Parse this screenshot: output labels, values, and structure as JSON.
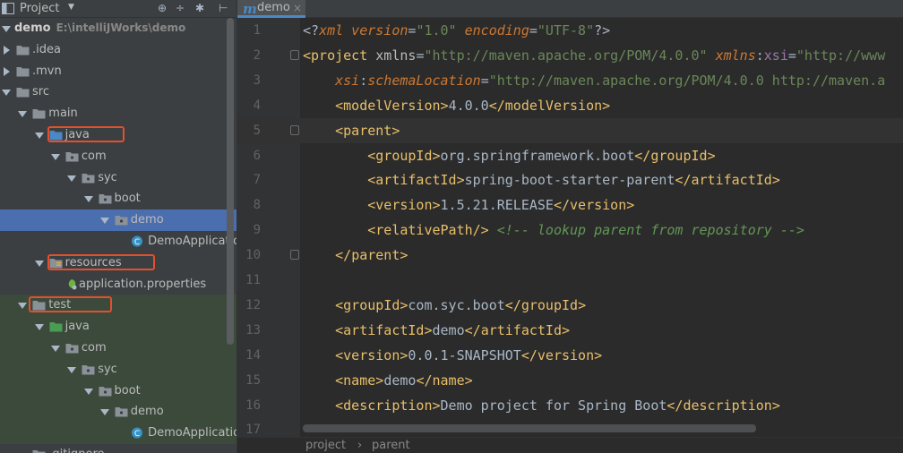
{
  "project_panel": {
    "title": "Project",
    "toolbar": [
      "⊕",
      "÷",
      "✱",
      "⊢"
    ],
    "tree": [
      {
        "label": "demo",
        "path": "E:\\intelliJWorks\\demo",
        "depth": 0,
        "expanded": true,
        "type": "module",
        "bold": true
      },
      {
        "label": ".idea",
        "depth": 0,
        "expanded": false,
        "type": "folder"
      },
      {
        "label": ".mvn",
        "depth": 0,
        "expanded": false,
        "type": "folder"
      },
      {
        "label": "src",
        "depth": 0,
        "expanded": true,
        "type": "folder"
      },
      {
        "label": "main",
        "depth": 1,
        "expanded": true,
        "type": "folder"
      },
      {
        "label": "java",
        "depth": 2,
        "expanded": true,
        "type": "source-folder",
        "highlight": true
      },
      {
        "label": "com",
        "depth": 3,
        "expanded": true,
        "type": "package"
      },
      {
        "label": "syc",
        "depth": 4,
        "expanded": true,
        "type": "package"
      },
      {
        "label": "boot",
        "depth": 5,
        "expanded": true,
        "type": "package"
      },
      {
        "label": "demo",
        "depth": 6,
        "expanded": true,
        "type": "package",
        "selected": true
      },
      {
        "label": "DemoApplication",
        "depth": 7,
        "type": "class"
      },
      {
        "label": "resources",
        "depth": 2,
        "expanded": true,
        "type": "resources-folder",
        "highlight": true
      },
      {
        "label": "application.properties",
        "depth": 3,
        "type": "properties"
      },
      {
        "label": "test",
        "depth": 1,
        "expanded": true,
        "type": "folder",
        "highlight": true,
        "test": true
      },
      {
        "label": "java",
        "depth": 2,
        "expanded": true,
        "type": "test-folder",
        "test": true
      },
      {
        "label": "com",
        "depth": 3,
        "expanded": true,
        "type": "package",
        "test": true
      },
      {
        "label": "syc",
        "depth": 4,
        "expanded": true,
        "type": "package",
        "test": true
      },
      {
        "label": "boot",
        "depth": 5,
        "expanded": true,
        "type": "package",
        "test": true
      },
      {
        "label": "demo",
        "depth": 6,
        "expanded": true,
        "type": "package",
        "test": true
      },
      {
        "label": "DemoApplicationT",
        "depth": 7,
        "type": "test-class",
        "test": true
      },
      {
        "label": ".gitignore",
        "depth": 1,
        "type": "file"
      }
    ]
  },
  "editor": {
    "tab": {
      "icon": "m",
      "label": "demo",
      "close": "×"
    },
    "current_line": 5,
    "lines": [
      {
        "n": "1",
        "fold": false,
        "tokens": [
          [
            "t-pi",
            "<?"
          ],
          [
            "t-pin",
            "xml version"
          ],
          [
            "t-pi",
            "="
          ],
          [
            "t-val",
            "\"1.0\""
          ],
          [
            "t-pi",
            " "
          ],
          [
            "t-pin",
            "encoding"
          ],
          [
            "t-pi",
            "="
          ],
          [
            "t-val",
            "\"UTF-8\""
          ],
          [
            "t-pi",
            "?>"
          ]
        ]
      },
      {
        "n": "2",
        "fold": true,
        "tokens": [
          [
            "t-br",
            "<"
          ],
          [
            "t-tag",
            "project"
          ],
          [
            "t-attr",
            " xmlns"
          ],
          [
            "t-txt",
            "="
          ],
          [
            "t-val",
            "\"http://maven.apache.org/POM/4.0.0\""
          ],
          [
            "t-attr",
            " "
          ],
          [
            "t-pin",
            "xmlns"
          ],
          [
            "t-txt",
            ":"
          ],
          [
            "t-ns",
            "xsi"
          ],
          [
            "t-txt",
            "="
          ],
          [
            "t-val",
            "\"http://www"
          ]
        ]
      },
      {
        "n": "3",
        "fold": false,
        "tokens": [
          [
            "t-txt",
            "    "
          ],
          [
            "t-pin",
            "xsi"
          ],
          [
            "t-txt",
            ":"
          ],
          [
            "t-pin",
            "schemaLocation"
          ],
          [
            "t-txt",
            "="
          ],
          [
            "t-val",
            "\"http://maven.apache.org/POM/4.0.0 http://maven.a"
          ]
        ]
      },
      {
        "n": "4",
        "fold": false,
        "tokens": [
          [
            "t-txt",
            "    "
          ],
          [
            "t-br",
            "<"
          ],
          [
            "t-tag",
            "modelVersion"
          ],
          [
            "t-br",
            ">"
          ],
          [
            "t-txt",
            "4.0.0"
          ],
          [
            "t-br",
            "</"
          ],
          [
            "t-tag",
            "modelVersion"
          ],
          [
            "t-br",
            ">"
          ]
        ]
      },
      {
        "n": "5",
        "fold": true,
        "tokens": [
          [
            "t-txt",
            "    "
          ],
          [
            "t-br",
            "<"
          ],
          [
            "t-tag",
            "parent"
          ],
          [
            "t-br",
            ">"
          ]
        ]
      },
      {
        "n": "6",
        "fold": false,
        "tokens": [
          [
            "t-txt",
            "        "
          ],
          [
            "t-br",
            "<"
          ],
          [
            "t-tag",
            "groupId"
          ],
          [
            "t-br",
            ">"
          ],
          [
            "t-txt",
            "org.springframework.boot"
          ],
          [
            "t-br",
            "</"
          ],
          [
            "t-tag",
            "groupId"
          ],
          [
            "t-br",
            ">"
          ]
        ]
      },
      {
        "n": "7",
        "fold": false,
        "tokens": [
          [
            "t-txt",
            "        "
          ],
          [
            "t-br",
            "<"
          ],
          [
            "t-tag",
            "artifactId"
          ],
          [
            "t-br",
            ">"
          ],
          [
            "t-txt",
            "spring-boot-starter-parent"
          ],
          [
            "t-br",
            "</"
          ],
          [
            "t-tag",
            "artifactId"
          ],
          [
            "t-br",
            ">"
          ]
        ]
      },
      {
        "n": "8",
        "fold": false,
        "tokens": [
          [
            "t-txt",
            "        "
          ],
          [
            "t-br",
            "<"
          ],
          [
            "t-tag",
            "version"
          ],
          [
            "t-br",
            ">"
          ],
          [
            "t-txt",
            "1.5.21.RELEASE"
          ],
          [
            "t-br",
            "</"
          ],
          [
            "t-tag",
            "version"
          ],
          [
            "t-br",
            ">"
          ]
        ]
      },
      {
        "n": "9",
        "fold": false,
        "tokens": [
          [
            "t-txt",
            "        "
          ],
          [
            "t-br",
            "<"
          ],
          [
            "t-tag",
            "relativePath"
          ],
          [
            "t-br",
            "/>"
          ],
          [
            "t-txt",
            " "
          ],
          [
            "t-cmt",
            "<!-- lookup parent from repository -->"
          ]
        ]
      },
      {
        "n": "10",
        "fold": true,
        "tokens": [
          [
            "t-txt",
            "    "
          ],
          [
            "t-br",
            "</"
          ],
          [
            "t-tag",
            "parent"
          ],
          [
            "t-br",
            ">"
          ]
        ]
      },
      {
        "n": "11",
        "fold": false,
        "tokens": []
      },
      {
        "n": "12",
        "fold": false,
        "tokens": [
          [
            "t-txt",
            "    "
          ],
          [
            "t-br",
            "<"
          ],
          [
            "t-tag",
            "groupId"
          ],
          [
            "t-br",
            ">"
          ],
          [
            "t-txt",
            "com.syc.boot"
          ],
          [
            "t-br",
            "</"
          ],
          [
            "t-tag",
            "groupId"
          ],
          [
            "t-br",
            ">"
          ]
        ]
      },
      {
        "n": "13",
        "fold": false,
        "tokens": [
          [
            "t-txt",
            "    "
          ],
          [
            "t-br",
            "<"
          ],
          [
            "t-tag",
            "artifactId"
          ],
          [
            "t-br",
            ">"
          ],
          [
            "t-txt",
            "demo"
          ],
          [
            "t-br",
            "</"
          ],
          [
            "t-tag",
            "artifactId"
          ],
          [
            "t-br",
            ">"
          ]
        ]
      },
      {
        "n": "14",
        "fold": false,
        "tokens": [
          [
            "t-txt",
            "    "
          ],
          [
            "t-br",
            "<"
          ],
          [
            "t-tag",
            "version"
          ],
          [
            "t-br",
            ">"
          ],
          [
            "t-txt",
            "0.0.1-SNAPSHOT"
          ],
          [
            "t-br",
            "</"
          ],
          [
            "t-tag",
            "version"
          ],
          [
            "t-br",
            ">"
          ]
        ]
      },
      {
        "n": "15",
        "fold": false,
        "tokens": [
          [
            "t-txt",
            "    "
          ],
          [
            "t-br",
            "<"
          ],
          [
            "t-tag",
            "name"
          ],
          [
            "t-br",
            ">"
          ],
          [
            "t-txt",
            "demo"
          ],
          [
            "t-br",
            "</"
          ],
          [
            "t-tag",
            "name"
          ],
          [
            "t-br",
            ">"
          ]
        ]
      },
      {
        "n": "16",
        "fold": false,
        "tokens": [
          [
            "t-txt",
            "    "
          ],
          [
            "t-br",
            "<"
          ],
          [
            "t-tag",
            "description"
          ],
          [
            "t-br",
            ">"
          ],
          [
            "t-txt",
            "Demo project for Spring Boot"
          ],
          [
            "t-br",
            "</"
          ],
          [
            "t-tag",
            "description"
          ],
          [
            "t-br",
            ">"
          ]
        ]
      },
      {
        "n": "17",
        "fold": false,
        "tokens": []
      }
    ],
    "breadcrumb": [
      "project",
      "parent"
    ],
    "breadcrumb_sep": "›"
  },
  "colors": {
    "highlight_box": "#e2502d",
    "selection": "#4b6eaf",
    "source_folder": "#4a88c7",
    "test_folder": "#499c54",
    "package": "#8a9199"
  }
}
